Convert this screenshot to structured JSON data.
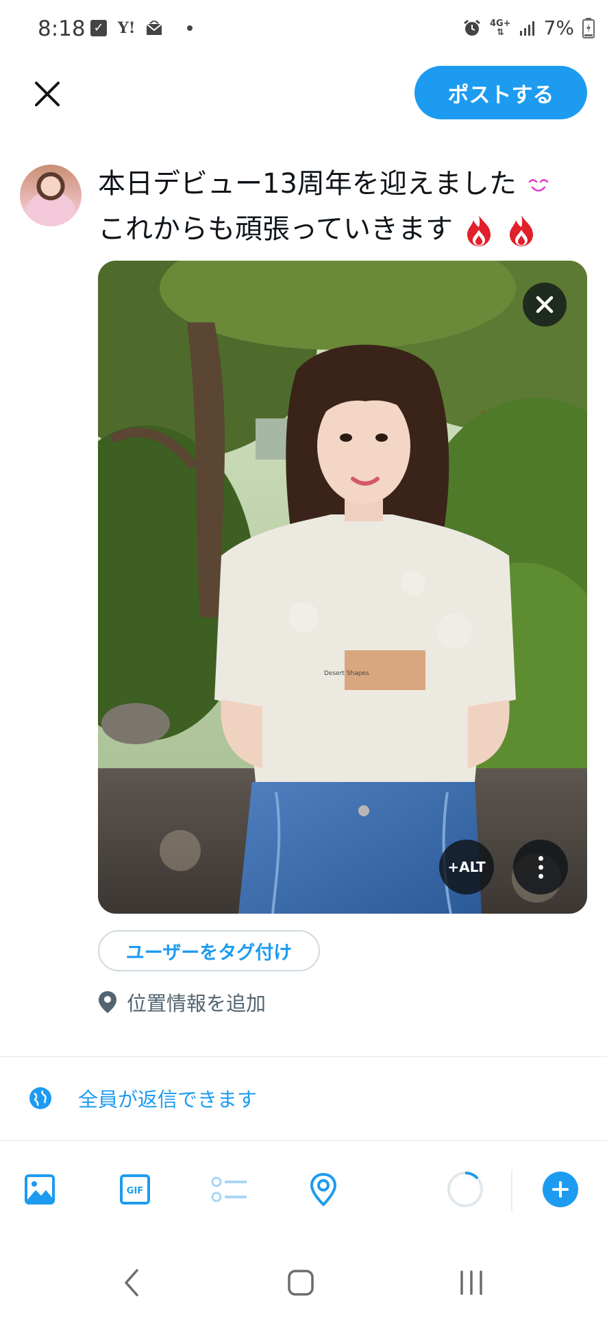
{
  "status_bar": {
    "time": "8:18",
    "network": "4G+",
    "battery": "7%",
    "icons": [
      "checkbox-icon",
      "yahoo-icon",
      "mail-icon",
      "dot-icon",
      "alarm-icon",
      "network-icon",
      "signal-icon",
      "battery-icon"
    ],
    "yahoo_label": "Y!"
  },
  "header": {
    "close_icon": "close-icon",
    "post_label": "ポストする"
  },
  "composer": {
    "text_line1": "本日デビュー13周年を迎えました",
    "text_line2": "これからも頑張っていきます"
  },
  "media": {
    "alt_label": "+ALT",
    "shirt_print": "Desert Shapes"
  },
  "tag_users_label": "ユーザーをタグ付け",
  "location_label": "位置情報を追加",
  "reply_setting_label": "全員が返信できます",
  "toolbar": {
    "items": [
      "image-icon",
      "gif-icon",
      "poll-icon",
      "location-icon",
      "progress-ring",
      "add-icon"
    ],
    "gif_text": "GIF"
  },
  "colors": {
    "accent": "#1d9bf0",
    "text": "#0f1419",
    "secondary": "#536471",
    "divider": "#e1e8ed"
  }
}
